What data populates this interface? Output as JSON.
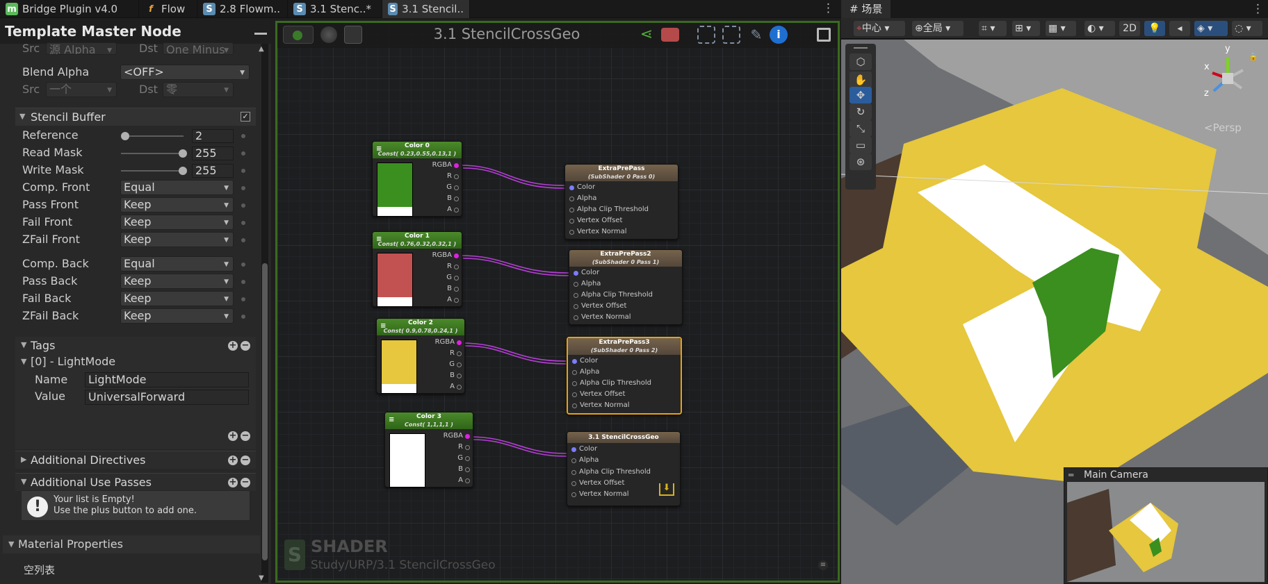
{
  "tabs": [
    {
      "label": "Bridge Plugin v4.0",
      "icon": "unity-m-icon",
      "color": "#5cb85c",
      "glyph": "m"
    },
    {
      "label": "Flow",
      "icon": "function-icon",
      "color": "#e8a33b",
      "glyph": "f"
    },
    {
      "label": "2.8 Flowm..",
      "icon": "shader-icon",
      "color": "#5c8bb0",
      "glyph": "S"
    },
    {
      "label": "3.1 Stenc..*",
      "icon": "shader-icon",
      "color": "#5c8bb0",
      "glyph": "S"
    },
    {
      "label": "3.1 Stencil..",
      "icon": "shader-icon",
      "color": "#5c8bb0",
      "glyph": "S"
    }
  ],
  "inspector": {
    "title": "Template Master Node",
    "blend_color_row": {
      "src_label": "Src",
      "src_value": "源 Alpha",
      "dst_label": "Dst",
      "dst_value": "One Minus"
    },
    "blend_alpha": {
      "label": "Blend Alpha",
      "value": "<OFF>"
    },
    "blend_alpha_row": {
      "src_label": "Src",
      "src_value": "一个",
      "dst_label": "Dst",
      "dst_value": "零"
    },
    "stencil": {
      "title": "Stencil Buffer",
      "enabled": true,
      "reference": {
        "label": "Reference",
        "value": "2",
        "level": 0.0
      },
      "read_mask": {
        "label": "Read Mask",
        "value": "255",
        "level": 1.0
      },
      "write_mask": {
        "label": "Write Mask",
        "value": "255",
        "level": 1.0
      },
      "front": [
        {
          "label": "Comp. Front",
          "value": "Equal"
        },
        {
          "label": "Pass Front",
          "value": "Keep"
        },
        {
          "label": "Fail Front",
          "value": "Keep"
        },
        {
          "label": "ZFail Front",
          "value": "Keep"
        }
      ],
      "back": [
        {
          "label": "Comp. Back",
          "value": "Equal"
        },
        {
          "label": "Pass Back",
          "value": "Keep"
        },
        {
          "label": "Fail Back",
          "value": "Keep"
        },
        {
          "label": "ZFail Back",
          "value": "Keep"
        }
      ]
    },
    "tags": {
      "title": "Tags",
      "item_title": "[0] - LightMode",
      "name_label": "Name",
      "name_value": "LightMode",
      "value_label": "Value",
      "value_value": "UniversalForward"
    },
    "additional_directives": "Additional Directives",
    "additional_use_passes": "Additional Use Passes",
    "empty_msg_1": "Your list is Empty!",
    "empty_msg_2": "Use the plus button to add one.",
    "material_properties": "Material Properties",
    "empty_list": "空列表"
  },
  "graph": {
    "title": "3.1 StencilCrossGeo",
    "watermark_title": "SHADER",
    "watermark_path": "Study/URP/3.1 StencilCrossGeo",
    "color_nodes": [
      {
        "title": "Color 0",
        "subtitle": "Const( 0.23,0.55,0.13,1 )",
        "swatch": "#3a8f1e"
      },
      {
        "title": "Color 1",
        "subtitle": "Const( 0.76,0.32,0.32,1 )",
        "swatch": "#c25252"
      },
      {
        "title": "Color 2",
        "subtitle": "Const( 0.9,0.78,0.24,1 )",
        "swatch": "#e6c73d"
      },
      {
        "title": "Color 3",
        "subtitle": "Const( 1,1,1,1 )",
        "swatch": "#ffffff"
      }
    ],
    "color_ports": [
      "RGBA",
      "R",
      "G",
      "B",
      "A"
    ],
    "pass_nodes": [
      {
        "title": "ExtraPrePass",
        "subtitle": "(SubShader 0 Pass 0)"
      },
      {
        "title": "ExtraPrePass2",
        "subtitle": "(SubShader 0 Pass 1)"
      },
      {
        "title": "ExtraPrePass3",
        "subtitle": "(SubShader 0 Pass 2)"
      },
      {
        "title": "3.1 StencilCrossGeo",
        "subtitle": ""
      }
    ],
    "pass_ports": [
      "Color",
      "Alpha",
      "Alpha Clip Threshold",
      "Vertex Offset",
      "Vertex Normal"
    ]
  },
  "scene": {
    "tab": "# 场景",
    "toolbar": {
      "pivot": "中心",
      "space": "全局",
      "mode2d": "2D"
    },
    "persp": "<Persp",
    "axes": {
      "x": "x",
      "y": "y",
      "z": "z"
    },
    "camera_title": "Main Camera"
  },
  "colors": {
    "yellow": "#e6c73d",
    "green": "#3a8f1e",
    "white": "#ffffff",
    "accent_border": "#3a6a1f"
  }
}
